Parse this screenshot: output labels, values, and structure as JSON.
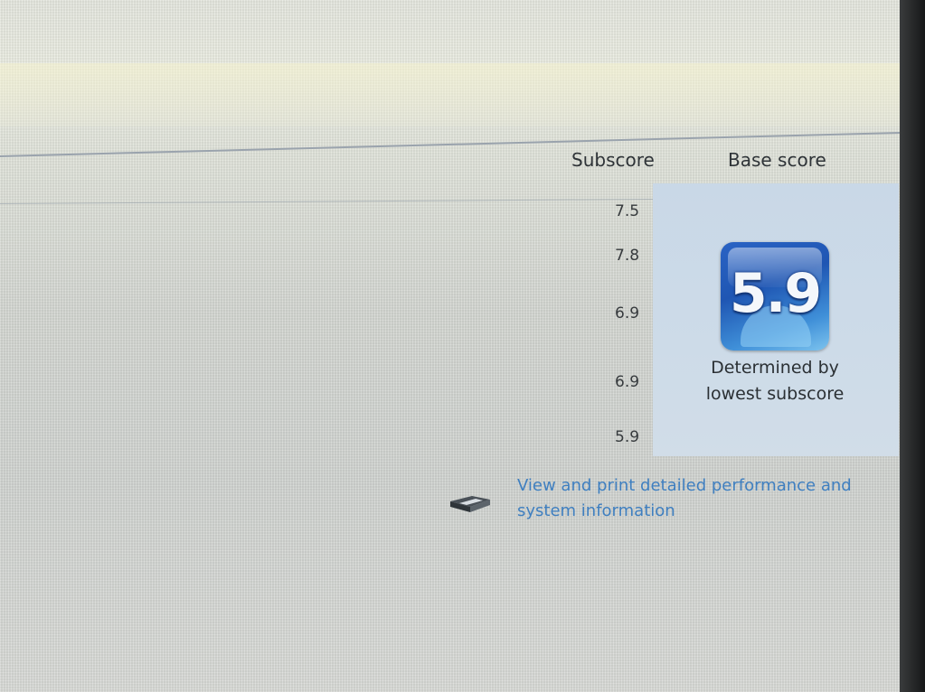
{
  "headers": {
    "subscore": "Subscore",
    "base_score": "Base score"
  },
  "subscores": [
    "7.5",
    "7.8",
    "6.9",
    "6.9",
    "5.9"
  ],
  "base_score": {
    "value": "5.9",
    "note_line1": "Determined by",
    "note_line2": "lowest subscore"
  },
  "link": {
    "text": "View and print detailed performance and system information",
    "icon": "printer-icon"
  },
  "colors": {
    "badge_blue": "#2a63c4",
    "panel_bg": "#c9d8e7",
    "link": "#3f7fc0"
  }
}
